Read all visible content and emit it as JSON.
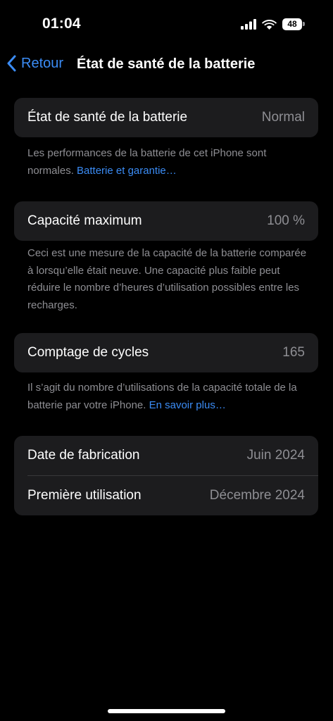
{
  "status_bar": {
    "time": "01:04",
    "battery_level": "48",
    "icons": [
      "signal-icon",
      "wifi-icon",
      "battery-icon"
    ]
  },
  "nav": {
    "back_label": "Retour",
    "back_icon": "chevron-left-icon",
    "title": "État de santé de la batterie"
  },
  "sections": {
    "health": {
      "label": "État de santé de la batterie",
      "value": "Normal",
      "footnote": "Les performances de la batterie de cet iPhone sont normales. ",
      "footnote_link": "Batterie et garantie…"
    },
    "capacity": {
      "label": "Capacité maximum",
      "value": "100 %",
      "footnote": "Ceci est une mesure de la capacité de la batterie comparée à lorsqu’elle était neuve. Une capacité plus faible peut réduire le nombre d’heures d’utilisation possibles entre les recharges."
    },
    "cycles": {
      "label": "Comptage de cycles",
      "value": "165",
      "footnote": "Il s’agit du nombre d’utilisations de la capacité totale de la batterie par votre iPhone. ",
      "footnote_link": "En savoir plus…"
    },
    "dates": {
      "manufacture_label": "Date de fabrication",
      "manufacture_value": "Juin 2024",
      "first_use_label": "Première utilisation",
      "first_use_value": "Décembre 2024"
    }
  },
  "colors": {
    "background": "#000000",
    "card": "#1c1c1e",
    "accent": "#3b8cf5",
    "secondary_text": "#8e8e93"
  }
}
